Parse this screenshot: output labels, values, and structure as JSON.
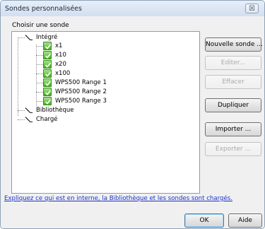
{
  "window": {
    "title": "Sondes personnalisées",
    "close_label": "☒"
  },
  "group": {
    "label": "Choisir une sonde"
  },
  "tree": {
    "integrated": {
      "label": "Intégré",
      "children": [
        "x1",
        "x10",
        "x20",
        "x100",
        "WPS500 Range 1",
        "WPS500 Range 2",
        "WPS500 Range 3"
      ]
    },
    "library": {
      "label": "Bibliothèque"
    },
    "loaded": {
      "label": "Chargé"
    }
  },
  "buttons": {
    "new_probe": "Nouvelle sonde ...",
    "edit": "Editer...",
    "delete": "Effacer",
    "duplicate": "Dupliquer",
    "import": "Importer ...",
    "export": "Exporter ...",
    "ok": "OK",
    "help": "Aide"
  },
  "help_link": "Expliquez ce qui est en interne, la Bibliothèque et les sondes sont chargés.",
  "colors": {
    "link": "#1a33cc",
    "check_green": "#42b21e"
  }
}
